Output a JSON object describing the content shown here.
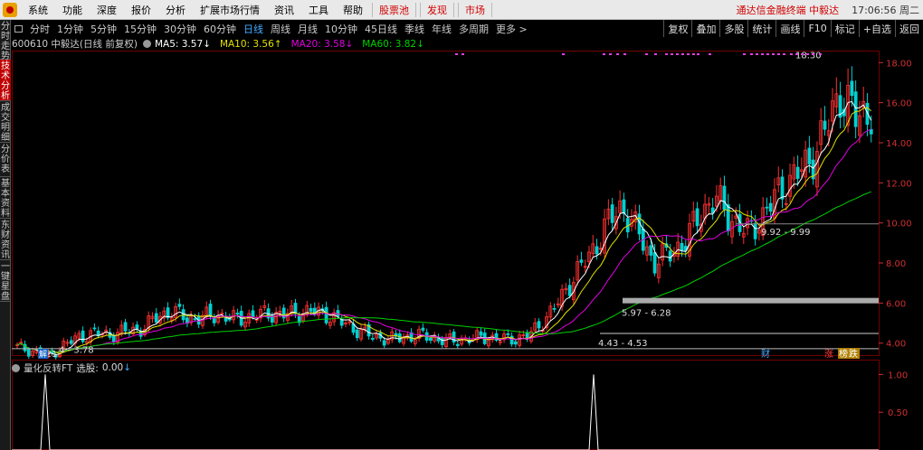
{
  "menubar": {
    "items": [
      "系统",
      "功能",
      "深度",
      "报价",
      "分析",
      "扩展市场行情",
      "资讯",
      "工具",
      "帮助"
    ],
    "red_items": [
      "股票池",
      "发现",
      "市场"
    ],
    "ticker": "通达信金融终端  中毅达",
    "clock": "17:06:56 周二"
  },
  "left_tabs": [
    "分时走势",
    "技术分析",
    "成交明细",
    "分价表",
    "基本资料",
    "东财资讯",
    "一键星盘"
  ],
  "left_tab_active": 1,
  "periods": [
    "分时",
    "1分钟",
    "5分钟",
    "15分钟",
    "30分钟",
    "60分钟",
    "日线",
    "周线",
    "月线",
    "10分钟",
    "45日线",
    "季线",
    "年线",
    "多周期",
    "更多 >"
  ],
  "period_active": 6,
  "right_tools": [
    "复权",
    "叠加",
    "多股",
    "统计",
    "画线",
    "F10",
    "标记",
    "+自选",
    "返回"
  ],
  "info": {
    "stock": "600610 中毅达(日线 前复权)",
    "ma5": "MA5: 3.57↓",
    "ma10": "MA10: 3.56↑",
    "ma20": "MA20: 3.58↓",
    "ma60": "MA60: 3.82↓"
  },
  "colors": {
    "up": "#ff3030",
    "down": "#00d0d0",
    "ma5": "#ffffff",
    "ma10": "#e0e000",
    "ma20": "#e000e0",
    "ma60": "#00d000",
    "axis": "#d03030"
  },
  "price_axis": {
    "ticks": [
      "18.00",
      "16.00",
      "14.00",
      "12.00",
      "10.00",
      "8.00",
      "6.00",
      "4.00"
    ],
    "min": 3.4,
    "max": 18.6
  },
  "annotations": {
    "high": "18.30",
    "zone1": "9.92 - 9.99",
    "zone2": "5.97 - 6.28",
    "zone3": "4.43 - 4.53",
    "low": "3.21",
    "low_range": "4 - 3.78"
  },
  "markers": {
    "jie": "解",
    "cai": "财",
    "zhang": "涨",
    "bang": "榜",
    "die": "跌"
  },
  "indicator": {
    "name": "量化反转FT",
    "label": "选股:",
    "value": "0.00",
    "arrow": "↓",
    "ticks": [
      "1.00",
      "0.50"
    ]
  },
  "chart_data": {
    "type": "candlestick",
    "title": "600610 中毅达(日线 前复权)",
    "ylim": [
      3.4,
      18.6
    ],
    "yticks": [
      4,
      6,
      8,
      10,
      12,
      14,
      16,
      18
    ],
    "key_levels": {
      "period_high": 18.3,
      "period_low": 3.21,
      "support_zones": [
        [
          9.92,
          9.99
        ],
        [
          5.97,
          6.28
        ],
        [
          4.43,
          4.53
        ]
      ]
    },
    "moving_averages": {
      "MA5": 3.57,
      "MA10": 3.56,
      "MA20": 3.58,
      "MA60": 3.82
    },
    "close_path": [
      3.8,
      3.6,
      3.3,
      3.9,
      4.3,
      4.5,
      4.4,
      4.6,
      4.7,
      5.3,
      5.6,
      5.2,
      5.3,
      5.4,
      5.2,
      5.3,
      5.5,
      5.4,
      5.5,
      5.6,
      5.4,
      5.0,
      4.6,
      4.3,
      4.2,
      4.3,
      4.4,
      4.2,
      4.1,
      4.2,
      4.3,
      4.2,
      4.2,
      4.4,
      5.2,
      6.2,
      7.5,
      8.5,
      10.0,
      10.8,
      9.5,
      8.0,
      8.5,
      9.0,
      10.5,
      11.2,
      10.2,
      9.5,
      10.3,
      11.5,
      12.3,
      13.0,
      14.5,
      16.5,
      15.3,
      15.6
    ],
    "indicator": {
      "name": "量化反转FT",
      "series": "选股",
      "last": 0.0,
      "ylim": [
        0,
        1.1
      ],
      "yticks": [
        0.5,
        1.0
      ]
    }
  }
}
